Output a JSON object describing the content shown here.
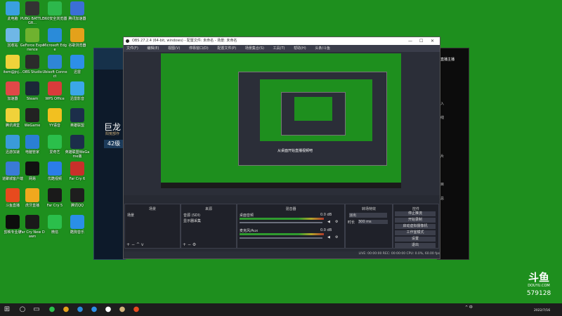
{
  "desktop": {
    "icons": [
      {
        "label": "此电脑",
        "color": "#3aa0e0"
      },
      {
        "label": "PUBG BATTLEGR...",
        "color": "#333333"
      },
      {
        "label": "360安全浏览器",
        "color": "#2db84c"
      },
      {
        "label": "腾讯加速器",
        "color": "#3b6fd6"
      },
      {
        "label": "回收站",
        "color": "#6fb7e6"
      },
      {
        "label": "GeForce Experience",
        "color": "#6fb22f"
      },
      {
        "label": "Microsoft Edge",
        "color": "#2a8bd9"
      },
      {
        "label": "谷歌浏览器",
        "color": "#e4a11b"
      },
      {
        "label": "item@jnj...",
        "color": "#f0d23a"
      },
      {
        "label": "OBS Studio",
        "color": "#2b2b2b"
      },
      {
        "label": "Ubisoft Connect",
        "color": "#2f86d6"
      },
      {
        "label": "迅雷",
        "color": "#2d8fe8"
      },
      {
        "label": "加速器",
        "color": "#e04848"
      },
      {
        "label": "Steam",
        "color": "#1b2838"
      },
      {
        "label": "WPS Office",
        "color": "#d93b3b"
      },
      {
        "label": "迅雷影音",
        "color": "#3ba7e8"
      },
      {
        "label": "腾讯课堂",
        "color": "#f0d23a"
      },
      {
        "label": "WeGame",
        "color": "#222222"
      },
      {
        "label": "YY语音",
        "color": "#f2c020"
      },
      {
        "label": "英雄联盟",
        "color": "#1c2e4a"
      },
      {
        "label": "迅游加速",
        "color": "#3a9bd9"
      },
      {
        "label": "电脑管家",
        "color": "#2a7fd4"
      },
      {
        "label": "爱奇艺",
        "color": "#2bbf4b"
      },
      {
        "label": "英雄联盟WeGame版",
        "color": "#1c2e4a"
      },
      {
        "label": "道聚城客户端",
        "color": "#3a7bd5"
      },
      {
        "label": "网易",
        "color": "#111111"
      },
      {
        "label": "优酷视频",
        "color": "#2b7de8"
      },
      {
        "label": "Far Cry 6",
        "color": "#c8302a"
      },
      {
        "label": "斗鱼直播",
        "color": "#e74a1e"
      },
      {
        "label": "虎牙直播",
        "color": "#f0a81e"
      },
      {
        "label": "Far Cry 5",
        "color": "#1a1a1a"
      },
      {
        "label": "腾讯QQ",
        "color": "#1e1e1e"
      },
      {
        "label": "剪映专业版",
        "color": "#0d0d0d"
      },
      {
        "label": "Far Cry New Dawn",
        "color": "#1a1a1a"
      },
      {
        "label": "微信",
        "color": "#2bbf4b"
      },
      {
        "label": "酷狗音乐",
        "color": "#2a8fe8"
      }
    ]
  },
  "lol_window": {
    "title": "巨龙",
    "subtitle": "阳荒部作",
    "level": "42级"
  },
  "right_panel": {
    "title": "直播主播",
    "items": [
      "入",
      "线",
      "片",
      "目",
      "总"
    ]
  },
  "obs": {
    "title": "OBS 27.2.4 (64-bit, windows) - 配置文件: 未命名 - 场景: 未命名",
    "menu": [
      "文件(F)",
      "编辑(E)",
      "视图(V)",
      "停靠窗口(D)",
      "配置文件(P)",
      "场景集合(S)",
      "工具(T)",
      "帮助(H)",
      "头条/斗鱼"
    ],
    "docks": {
      "scenes": {
        "header": "场景",
        "item": "场景"
      },
      "sources": {
        "header": "来源",
        "items": [
          "音源 (SDI)",
          "显示器采集"
        ]
      },
      "mixer": {
        "header": "混音器",
        "ch1": "桌面音频",
        "ch2": "麦克风/Aux",
        "db1": "0.0 dB",
        "db2": "0.0 dB"
      },
      "transitions": {
        "header": "转场特效",
        "type": "淡出",
        "duration_label": "时长",
        "duration": "300 ms"
      },
      "controls": {
        "header": "控件",
        "buttons": [
          "停止推流",
          "开始录制",
          "启动虚拟摄像机",
          "工作室模式",
          "设置",
          "退出"
        ]
      }
    },
    "status": "LIVE: 00:00:00   REC: 00:00:00   CPU: 0.0%, 60.00 fps",
    "nested_caption": "从桌面开始直播视频吧"
  },
  "douyu": {
    "logo": "斗鱼",
    "sub": "DOUYU.COM",
    "room": "579128",
    "date": "2022/7/16"
  },
  "taskbar": {
    "time": "",
    "tray": "^  中"
  }
}
